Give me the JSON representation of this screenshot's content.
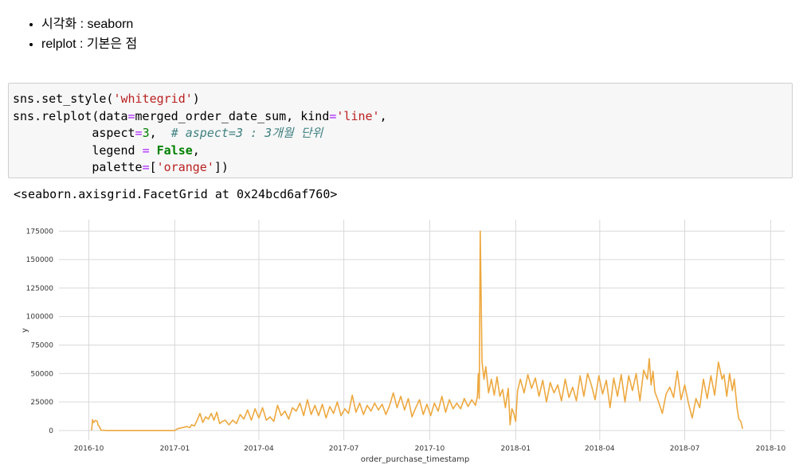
{
  "markdown": {
    "bullets": [
      "시각화 : seaborn",
      "relplot : 기본은 점"
    ]
  },
  "code_cell": {
    "line1": {
      "fn": "sns.set_style(",
      "arg": "'whitegrid'",
      "close": ")"
    },
    "line2": {
      "fn": "sns.relplot(data",
      "eq": "=",
      "val": "merged_order_date_sum, kind",
      "eq2": "=",
      "str": "'line'",
      "end": ","
    },
    "line3": {
      "key": "aspect",
      "eq": "=",
      "num": "3",
      "end": ",",
      "comment": "# aspect=3 : 3개월 단위"
    },
    "line4": {
      "key": "legend ",
      "eq": "=",
      "val": "False",
      "end": ","
    },
    "line5": {
      "key": "palette",
      "eq": "=",
      "open": "[",
      "str": "'orange'",
      "close": "])"
    }
  },
  "output_text": "<seaborn.axisgrid.FacetGrid at 0x24bcd6af760>",
  "chart_data": {
    "type": "line",
    "title": "",
    "xlabel": "order_purchase_timestamp",
    "ylabel": "y",
    "x_unit": "days since 2016-10-01",
    "xlim": [
      -32,
      745
    ],
    "ylim": [
      -8500,
      185000
    ],
    "grid": true,
    "legend": "none",
    "line_color": "#eda83f",
    "xticks": [
      {
        "value": 0,
        "label": "2016-10"
      },
      {
        "value": 92,
        "label": "2017-01"
      },
      {
        "value": 182,
        "label": "2017-04"
      },
      {
        "value": 273,
        "label": "2017-07"
      },
      {
        "value": 365,
        "label": "2017-10"
      },
      {
        "value": 457,
        "label": "2018-01"
      },
      {
        "value": 547,
        "label": "2018-04"
      },
      {
        "value": 638,
        "label": "2018-07"
      },
      {
        "value": 730,
        "label": "2018-10"
      }
    ],
    "yticks": [
      {
        "value": 0,
        "label": "0"
      },
      {
        "value": 25000,
        "label": "25000"
      },
      {
        "value": 50000,
        "label": "50000"
      },
      {
        "value": 75000,
        "label": "75000"
      },
      {
        "value": 100000,
        "label": "100000"
      },
      {
        "value": 125000,
        "label": "125000"
      },
      {
        "value": 150000,
        "label": "150000"
      },
      {
        "value": 175000,
        "label": "175000"
      }
    ],
    "x": [
      3,
      4,
      5,
      7,
      9,
      10,
      11,
      13,
      20,
      92,
      95,
      100,
      105,
      108,
      110,
      113,
      116,
      119,
      122,
      125,
      128,
      131,
      134,
      137,
      140,
      143,
      146,
      150,
      154,
      158,
      162,
      166,
      170,
      174,
      178,
      182,
      186,
      190,
      194,
      198,
      202,
      206,
      210,
      214,
      218,
      222,
      226,
      230,
      234,
      238,
      242,
      246,
      250,
      254,
      258,
      262,
      266,
      270,
      274,
      278,
      282,
      286,
      290,
      294,
      298,
      302,
      306,
      310,
      314,
      318,
      322,
      326,
      330,
      334,
      338,
      342,
      346,
      350,
      354,
      358,
      362,
      366,
      370,
      374,
      378,
      382,
      386,
      390,
      394,
      398,
      402,
      406,
      410,
      414,
      416,
      417,
      418,
      419,
      421,
      423,
      425,
      428,
      431,
      434,
      437,
      440,
      443,
      446,
      449,
      451,
      453,
      455,
      457,
      459,
      462,
      466,
      470,
      474,
      478,
      482,
      486,
      490,
      494,
      498,
      502,
      506,
      510,
      514,
      518,
      522,
      526,
      530,
      534,
      538,
      542,
      546,
      550,
      554,
      558,
      562,
      566,
      570,
      574,
      578,
      582,
      586,
      590,
      594,
      598,
      600,
      602,
      604,
      606,
      610,
      614,
      618,
      622,
      626,
      630,
      634,
      638,
      642,
      646,
      650,
      654,
      658,
      662,
      666,
      670,
      674,
      678,
      680,
      683,
      686,
      689,
      691,
      694,
      696,
      698,
      700
    ],
    "y": [
      0,
      9500,
      7000,
      8800,
      8000,
      4500,
      4000,
      200,
      0,
      0,
      1500,
      2500,
      3500,
      2500,
      5000,
      4000,
      9000,
      15000,
      7000,
      12000,
      10000,
      15000,
      9000,
      16000,
      6000,
      8000,
      9000,
      5000,
      9000,
      6000,
      14000,
      10000,
      18000,
      9000,
      19000,
      11000,
      20000,
      9000,
      12000,
      8000,
      22000,
      13000,
      17000,
      10000,
      20000,
      17000,
      24000,
      13000,
      27000,
      14000,
      22000,
      13000,
      23000,
      11000,
      21000,
      15000,
      25000,
      13000,
      19000,
      15000,
      31000,
      16000,
      24000,
      14000,
      22000,
      17000,
      24000,
      18000,
      23000,
      14000,
      22000,
      33000,
      20000,
      30000,
      18000,
      28000,
      12000,
      20000,
      27000,
      14000,
      23000,
      13000,
      24000,
      17000,
      30000,
      16000,
      27000,
      19000,
      24000,
      19000,
      28000,
      21000,
      27000,
      22000,
      30000,
      50000,
      28000,
      175000,
      60000,
      45000,
      56000,
      33000,
      45000,
      31000,
      47000,
      30000,
      36000,
      20000,
      37000,
      5000,
      19000,
      15000,
      8000,
      35000,
      45000,
      33000,
      49000,
      37000,
      46000,
      30000,
      44000,
      25000,
      42000,
      33000,
      40000,
      26000,
      45000,
      29000,
      38000,
      26000,
      48000,
      30000,
      50000,
      40000,
      27000,
      48000,
      32000,
      44000,
      20000,
      46000,
      30000,
      49000,
      25000,
      48000,
      35000,
      50000,
      26000,
      53000,
      45000,
      63000,
      40000,
      52000,
      34000,
      25000,
      15000,
      32000,
      38000,
      29000,
      52000,
      27000,
      40000,
      24000,
      11000,
      28000,
      20000,
      45000,
      28000,
      48000,
      31000,
      60000,
      45000,
      49000,
      30000,
      50000,
      35000,
      45000,
      20000,
      10000,
      8000,
      1500
    ]
  }
}
